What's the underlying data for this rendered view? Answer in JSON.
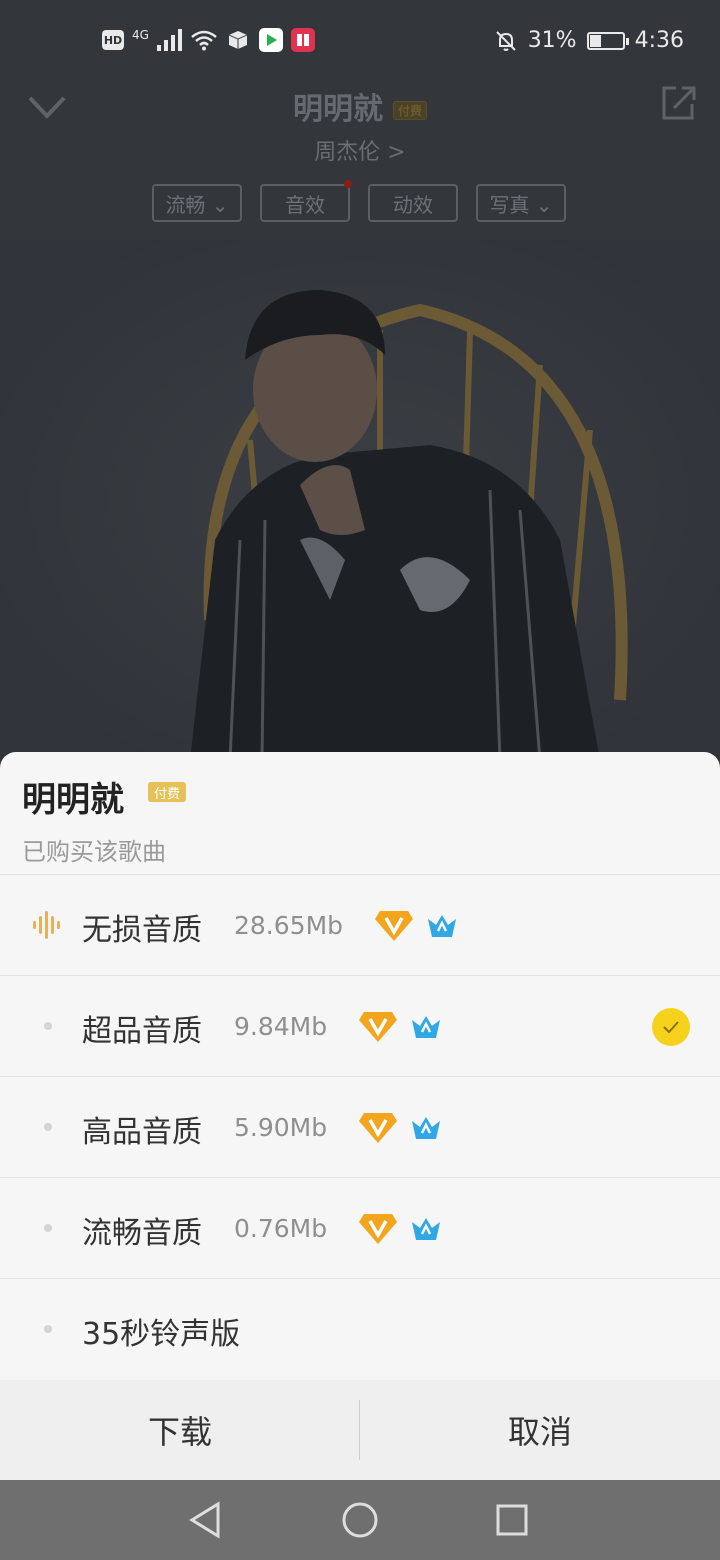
{
  "status_bar": {
    "hd": "HD",
    "network": "4G",
    "battery_percent": "31%",
    "battery_level": 0.31,
    "time": "4:36"
  },
  "player": {
    "title": "明明就",
    "title_tag": "付费",
    "artist": "周杰伦 >",
    "chips": [
      {
        "label": "流畅 ⌄"
      },
      {
        "label": "音效"
      },
      {
        "label": "动效"
      },
      {
        "label": "写真 ⌄"
      }
    ]
  },
  "sheet": {
    "title": "明明就",
    "badge": "付费",
    "subtitle": "已购买该歌曲",
    "options": [
      {
        "label": "无损音质",
        "size": "28.65Mb"
      },
      {
        "label": "超品音质",
        "size": "9.84Mb",
        "selected": true
      },
      {
        "label": "高品音质",
        "size": "5.90Mb"
      },
      {
        "label": "流畅音质",
        "size": "0.76Mb"
      },
      {
        "label": "35秒铃声版",
        "size": ""
      }
    ],
    "download_label": "下载",
    "cancel_label": "取消"
  },
  "colors": {
    "accent_yellow": "#f7d21c",
    "vip_gold": "#f2a51d",
    "svip_blue": "#31a8e6"
  }
}
